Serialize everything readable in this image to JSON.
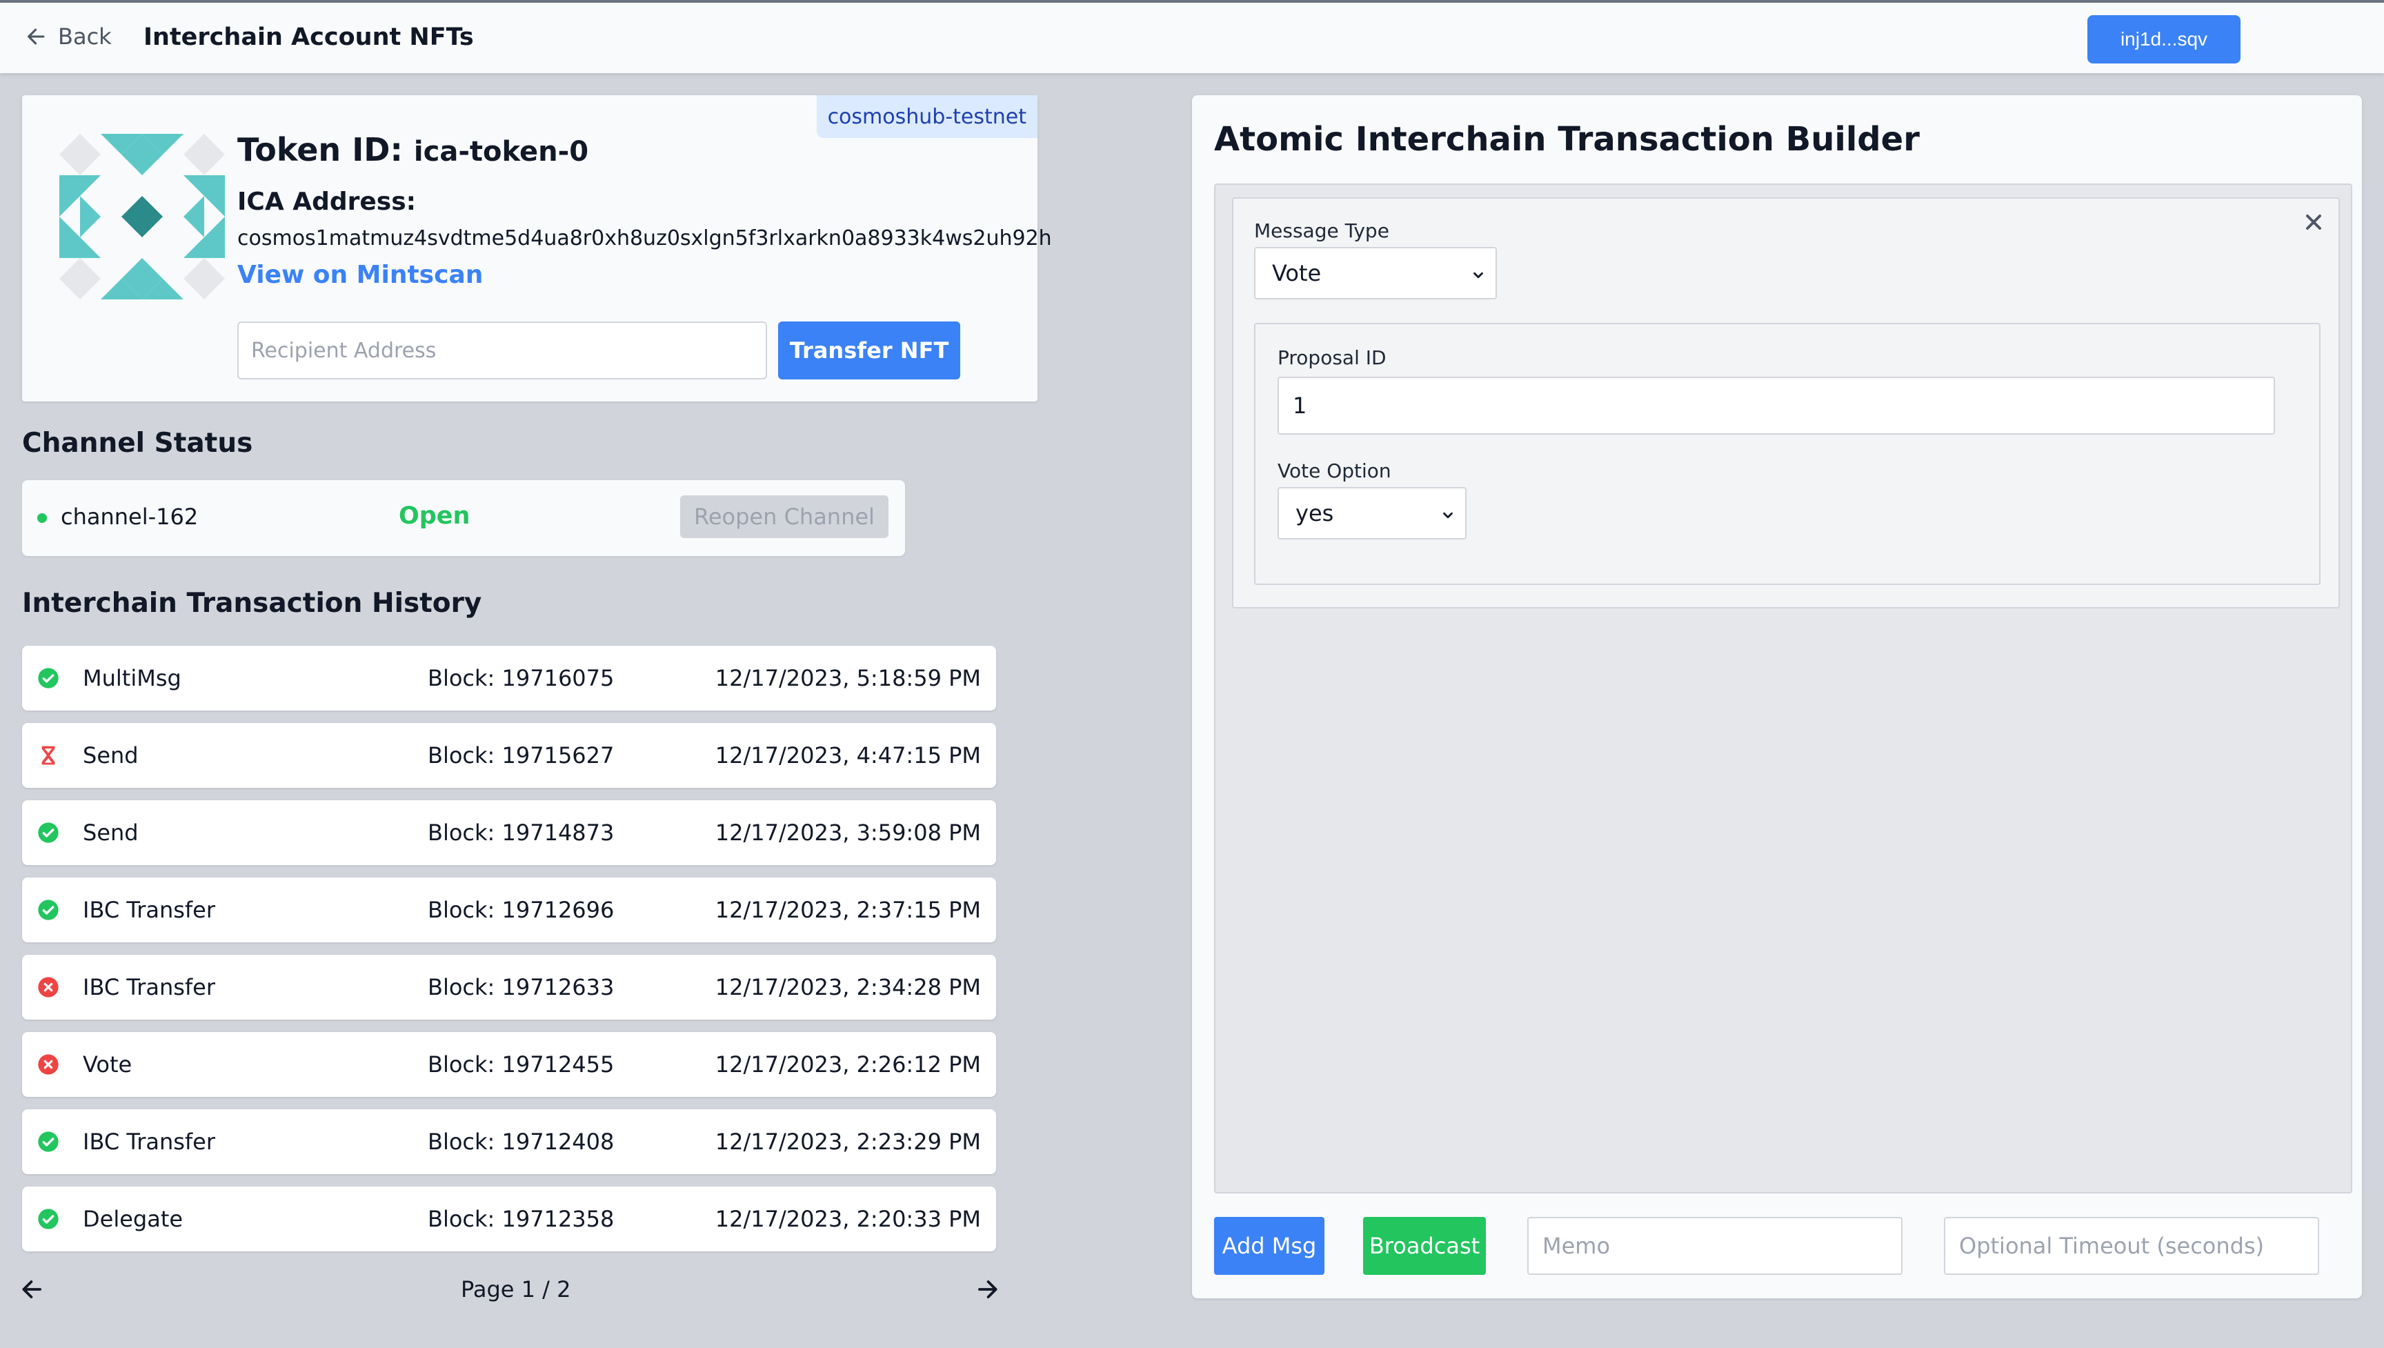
{
  "header": {
    "back_label": "Back",
    "title": "Interchain Account NFTs",
    "wallet_label": "inj1d...sqv"
  },
  "nft": {
    "chain_badge": "cosmoshub-testnet",
    "token_label": "Token ID:",
    "token_id": "ica-token-0",
    "ica_label": "ICA Address:",
    "ica_address": "cosmos1matmuz4svdtme5d4ua8r0xh8uz0sxlgn5f3rlxarkn0a8933k4ws2uh92h",
    "mintscan_link": "View on Mintscan",
    "recipient_placeholder": "Recipient Address",
    "transfer_label": "Transfer NFT",
    "identicon_colors": {
      "teal": "#5ec8c8",
      "dark": "#2b8a8a",
      "grey": "#e5e7eb"
    }
  },
  "channel": {
    "section_title": "Channel Status",
    "id": "channel-162",
    "status": "Open",
    "reopen_label": "Reopen Channel",
    "status_color": "#22c55e"
  },
  "history": {
    "section_title": "Interchain Transaction History",
    "rows": [
      {
        "status": "success",
        "type": "MultiMsg",
        "block": "Block: 19716075",
        "time": "12/17/2023, 5:18:59 PM"
      },
      {
        "status": "pending",
        "type": "Send",
        "block": "Block: 19715627",
        "time": "12/17/2023, 4:47:15 PM"
      },
      {
        "status": "success",
        "type": "Send",
        "block": "Block: 19714873",
        "time": "12/17/2023, 3:59:08 PM"
      },
      {
        "status": "success",
        "type": "IBC Transfer",
        "block": "Block: 19712696",
        "time": "12/17/2023, 2:37:15 PM"
      },
      {
        "status": "failed",
        "type": "IBC Transfer",
        "block": "Block: 19712633",
        "time": "12/17/2023, 2:34:28 PM"
      },
      {
        "status": "failed",
        "type": "Vote",
        "block": "Block: 19712455",
        "time": "12/17/2023, 2:26:12 PM"
      },
      {
        "status": "success",
        "type": "IBC Transfer",
        "block": "Block: 19712408",
        "time": "12/17/2023, 2:23:29 PM"
      },
      {
        "status": "success",
        "type": "Delegate",
        "block": "Block: 19712358",
        "time": "12/17/2023, 2:20:33 PM"
      }
    ],
    "page_label": "Page 1 / 2",
    "icon_colors": {
      "success": "#22c55e",
      "failed": "#ef4444",
      "pending": "#ef4444"
    }
  },
  "builder": {
    "title": "Atomic Interchain Transaction Builder",
    "message_type_label": "Message Type",
    "message_type_value": "Vote",
    "proposal_id_label": "Proposal ID",
    "proposal_id_value": "1",
    "vote_option_label": "Vote Option",
    "vote_option_value": "yes",
    "add_msg_label": "Add Msg",
    "broadcast_label": "Broadcast",
    "memo_placeholder": "Memo",
    "timeout_placeholder": "Optional Timeout (seconds)"
  }
}
